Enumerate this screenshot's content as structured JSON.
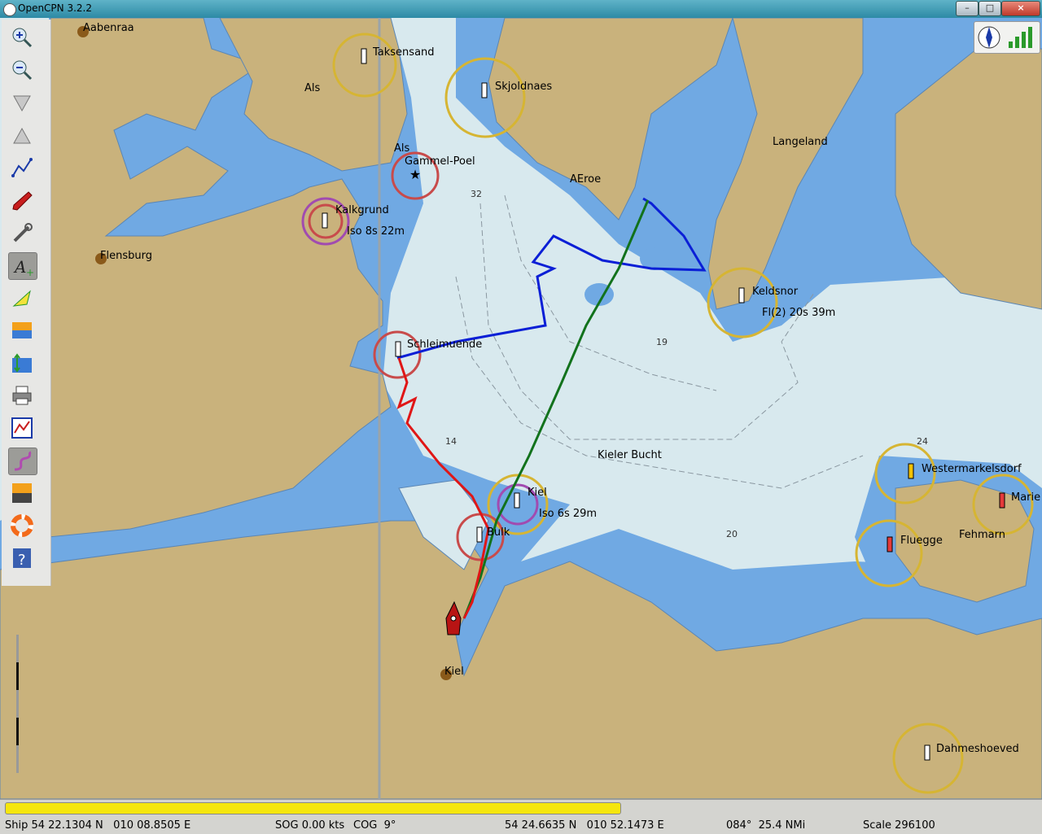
{
  "window": {
    "title": "OpenCPN 3.2.2",
    "minimize": "–",
    "maximize": "□",
    "close": "×"
  },
  "toolbar": [
    {
      "name": "zoom-in-icon",
      "tooltip": "Zoom in"
    },
    {
      "name": "zoom-out-icon",
      "tooltip": "Zoom out"
    },
    {
      "name": "scale-in-icon",
      "tooltip": "Shift up"
    },
    {
      "name": "scale-out-icon",
      "tooltip": "Shift down"
    },
    {
      "name": "route-icon",
      "tooltip": "Create route"
    },
    {
      "name": "follow-ship-icon",
      "tooltip": "Auto follow"
    },
    {
      "name": "settings-icon",
      "tooltip": "Options"
    },
    {
      "name": "text-icon",
      "tooltip": "Show ENC text"
    },
    {
      "name": "current-icon",
      "tooltip": "Show currents"
    },
    {
      "name": "tide-icon",
      "tooltip": "Show tides"
    },
    {
      "name": "tide-station-icon",
      "tooltip": "Tide station"
    },
    {
      "name": "print-icon",
      "tooltip": "Print chart"
    },
    {
      "name": "route-manager-icon",
      "tooltip": "Route manager"
    },
    {
      "name": "track-icon",
      "tooltip": "Track"
    },
    {
      "name": "color-scheme-icon",
      "tooltip": "Color scheme"
    },
    {
      "name": "mob-icon",
      "tooltip": "Man overboard"
    },
    {
      "name": "help-icon",
      "tooltip": "About"
    }
  ],
  "chart": {
    "place_labels": [
      "Aabenraa",
      "Taksensand",
      "Als",
      "Skjoldnaes",
      "Als",
      "Gammel-Poel",
      "Langeland",
      "AEroe",
      "Kalkgrund",
      "Iso 8s 22m",
      "Flensburg",
      "Keldsnor",
      "Fl(2) 20s 39m",
      "Schleimuende",
      "Kieler Bucht",
      "Kiel",
      "Iso 6s 29m",
      "Bulk",
      "Westermarkelsdorf",
      "Marie",
      "Fluegge",
      "Fehmarn",
      "Kiel",
      "Dahmeshoeved"
    ],
    "depths": [
      "32",
      "19",
      "14",
      "20",
      "24"
    ],
    "colors": {
      "land": "#c9b27c",
      "shallow": "#70a9e3",
      "deep": "#d8e9ee",
      "route_blue": "#0b1fd6",
      "track_green": "#12721c",
      "track_red": "#e01616",
      "ship": "#b81414"
    }
  },
  "status": {
    "ship": "Ship 54 22.1304 N   010 08.8505 E",
    "sog": "SOG 0.00 kts",
    "cog": "COG  9°",
    "cursor": "54 24.6635 N   010 52.1473 E",
    "bearing": "084°  25.4 NMi",
    "scale": "Scale 296100",
    "progress": 0.59
  }
}
